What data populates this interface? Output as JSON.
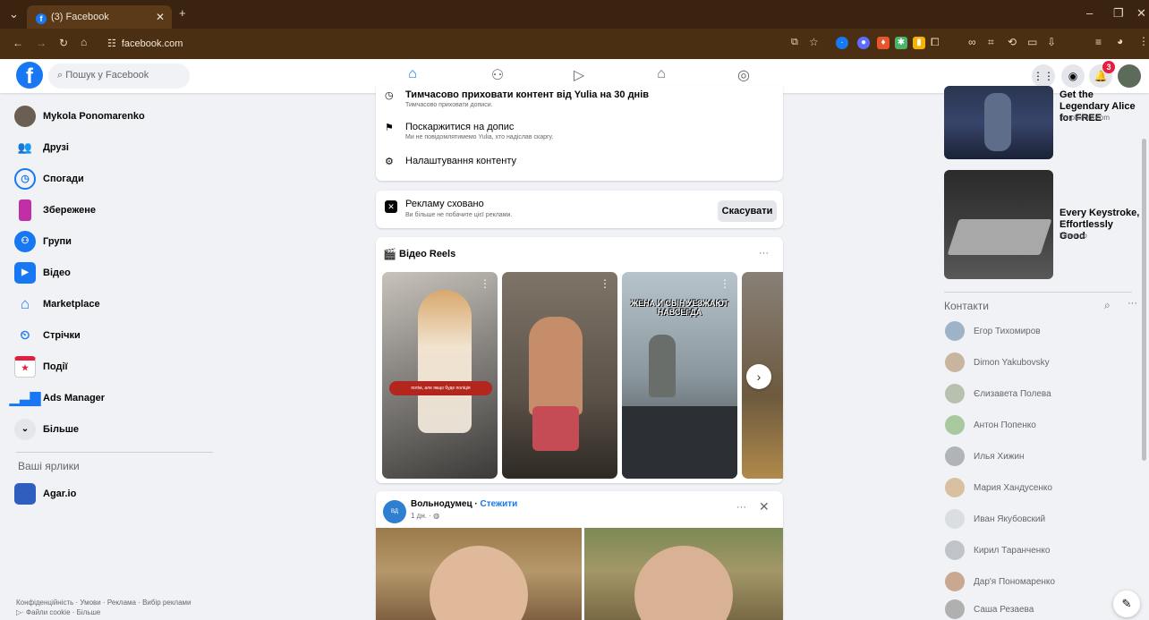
{
  "browser": {
    "tab_title": "(3) Facebook",
    "url": "facebook.com",
    "new_tab": "+",
    "min": "–",
    "restore": "❐",
    "close": "✕"
  },
  "header": {
    "search_placeholder": "Пошук у Facebook",
    "notifications_count": "3"
  },
  "left_nav": {
    "profile_name": "Mykola Ponomarenko",
    "items": [
      {
        "label": "Друзі"
      },
      {
        "label": "Спогади"
      },
      {
        "label": "Збережене"
      },
      {
        "label": "Групи"
      },
      {
        "label": "Відео"
      },
      {
        "label": "Marketplace"
      },
      {
        "label": "Стрічки"
      },
      {
        "label": "Події"
      },
      {
        "label": "Ads Manager"
      },
      {
        "label": "Більше"
      }
    ],
    "shortcuts_title": "Ваші ярлики",
    "shortcut": "Agar.io",
    "footer_line1": "Конфіденційність · Умови · Реклама · Вибір реклами",
    "footer_line2": "· Файли cookie · Більше"
  },
  "menu_card": {
    "item1_title": "Тимчасово приховати контент від Yulia на 30 днів",
    "item1_sub": "Тимчасово приховати дописи.",
    "item2_title": "Поскаржитися на допис",
    "item2_sub": "Ми не повідомлятимемо Yulia, хто надіслав скаргу.",
    "item3_title": "Налаштування контенту"
  },
  "hidden_ad": {
    "title": "Рекламу сховано",
    "subtitle": "Ви більше не побачите цієї реклами.",
    "cancel_label": "Скасувати"
  },
  "reels": {
    "title": "Відео Reels",
    "reel1_caption": "потім, але якщо буде поліція",
    "reel3_caption": "ЖЕНА И СЫН УЕЗЖАЮТ НАВСЕГДА"
  },
  "post": {
    "author": "Вольнодумец",
    "follow": "Стежити",
    "time": "1 дн. · ",
    "avatar_text": "ВД"
  },
  "ads": [
    {
      "title": "Get the Legendary Alice for FREE",
      "source": "lps.plarium.com"
    },
    {
      "title": "Every Keystroke, Effortlessly Good",
      "source": "lofree.co"
    }
  ],
  "contacts": {
    "title": "Контакти",
    "items": [
      {
        "name": "Егор Тихомиров",
        "color": "#9fb3c8"
      },
      {
        "name": "Dimon Yakubovsky",
        "color": "#c8b49f"
      },
      {
        "name": "Єлизавета Полева",
        "color": "#b8c0b0"
      },
      {
        "name": "Антон Попенко",
        "color": "#a8c8a0"
      },
      {
        "name": "Илья Хижин",
        "color": "#b0b3b8"
      },
      {
        "name": "Мария Хандусенко",
        "color": "#d8c0a0"
      },
      {
        "name": "Иван Якубовский",
        "color": "#dadde1"
      },
      {
        "name": "Кирил Таранченко",
        "color": "#c0c4c8"
      },
      {
        "name": "Дар'я Пономаренко",
        "color": "#c8a890"
      },
      {
        "name": "Саша Резаева",
        "color": "#b0b0b0"
      }
    ]
  }
}
